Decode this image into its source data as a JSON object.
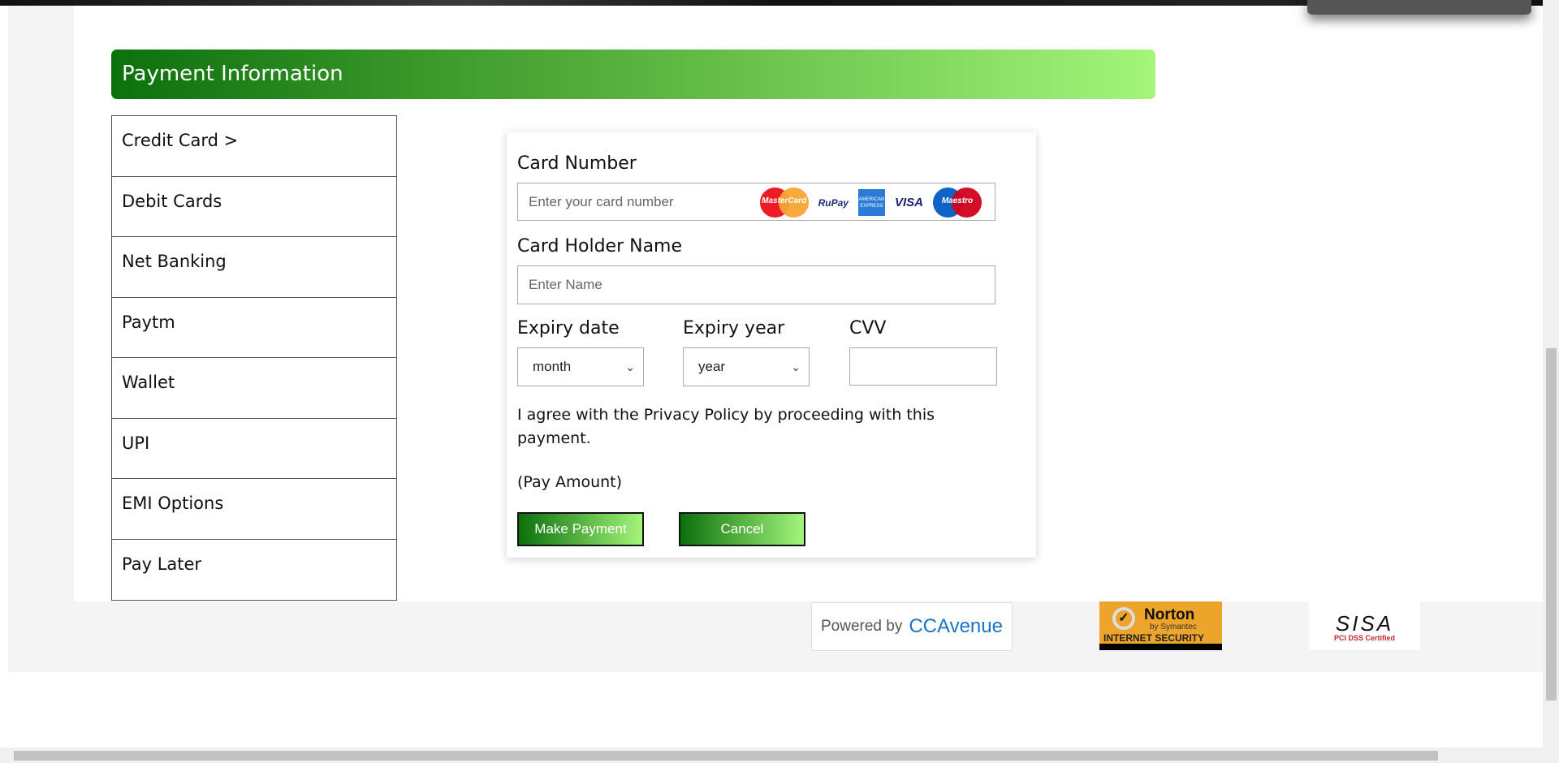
{
  "header": {
    "title": "Payment Information"
  },
  "sidebar": {
    "items": [
      {
        "label": "Credit Card >"
      },
      {
        "label": "Debit Cards"
      },
      {
        "label": "Net Banking"
      },
      {
        "label": "Paytm"
      },
      {
        "label": "Wallet"
      },
      {
        "label": "UPI"
      },
      {
        "label": "EMI Options"
      },
      {
        "label": "Pay Later"
      }
    ]
  },
  "form": {
    "card_number_label": "Card Number",
    "card_number_placeholder": "Enter your card number",
    "holder_label": "Card Holder Name",
    "holder_placeholder": "Enter Name",
    "expiry_date_label": "Expiry date",
    "expiry_date_value": "month",
    "expiry_year_label": "Expiry year",
    "expiry_year_value": "year",
    "cvv_label": "CVV",
    "cvv_value": "",
    "agree_text": "I agree with the Privacy Policy by proceeding with this payment.",
    "pay_amount": "(Pay Amount)",
    "make_payment": "Make Payment",
    "cancel": "Cancel",
    "card_logos": {
      "mastercard": "MasterCard",
      "rupay": "RuPay",
      "amex": "AMERICAN EXPRESS",
      "visa": "VISA",
      "maestro": "Maestro"
    }
  },
  "footer": {
    "ccavenue_powered": "Powered by",
    "ccavenue_brand": "CCAvenue",
    "norton": "Norton",
    "norton_sub": "by Symantec",
    "norton_badge": "INTERNET SECURITY",
    "sisa": "SISA",
    "sisa_sub": "PCI DSS Certified"
  },
  "colors": {
    "accent_dark": "#0c700c",
    "accent_light": "#a4f57a"
  }
}
